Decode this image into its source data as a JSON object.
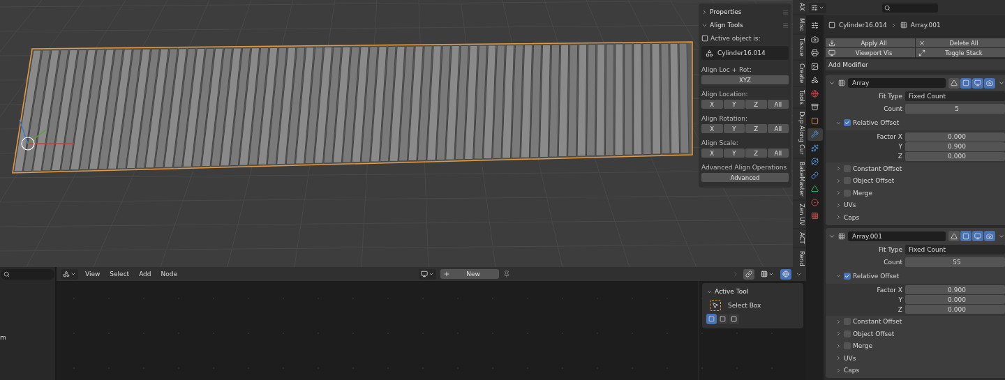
{
  "viewport": {
    "sidebar_panels": [
      {
        "title": "Properties",
        "expanded": false
      },
      {
        "title": "Align Tools",
        "expanded": true
      }
    ],
    "active_object_label": "Active object is:",
    "active_object": "Cylinder16.014",
    "align_groups": [
      {
        "label": "Align Loc + Rot:",
        "buttons": [
          "XYZ"
        ]
      },
      {
        "label": "Align Location:",
        "buttons": [
          "X",
          "Y",
          "Z",
          "All"
        ]
      },
      {
        "label": "Align Rotation:",
        "buttons": [
          "X",
          "Y",
          "Z",
          "All"
        ]
      },
      {
        "label": "Align Scale:",
        "buttons": [
          "X",
          "Y",
          "Z",
          "All"
        ]
      },
      {
        "label": "Advanced Align Operations",
        "buttons": [
          "Advanced"
        ]
      }
    ],
    "tabs": [
      "AX",
      "Misc",
      "Tissue",
      "Create",
      "Tools",
      "Dup Along Cur",
      "BakeMaster",
      "Zen UV",
      "ACT",
      "Rend"
    ]
  },
  "outliner": {
    "partial_text": "m"
  },
  "node_editor": {
    "menus": [
      "View",
      "Select",
      "Add",
      "Node"
    ],
    "new_button": "New",
    "active_tool": {
      "title": "Active Tool",
      "tool": "Select Box",
      "modes": [
        {
          "kind": "set",
          "selected": true
        },
        {
          "kind": "extend",
          "selected": false
        },
        {
          "kind": "subtract",
          "selected": false
        }
      ]
    }
  },
  "properties": {
    "tabs": [
      {
        "kind": "tool",
        "selected": false
      },
      {
        "kind": "render",
        "selected": false
      },
      {
        "kind": "output",
        "selected": false
      },
      {
        "kind": "view_layer",
        "selected": false
      },
      {
        "kind": "scene",
        "selected": false
      },
      {
        "kind": "world",
        "selected": false
      },
      {
        "kind": "collection",
        "selected": false
      },
      {
        "kind": "object",
        "selected": false
      },
      {
        "kind": "modifier",
        "selected": true
      },
      {
        "kind": "particles",
        "selected": false
      },
      {
        "kind": "physics",
        "selected": false
      },
      {
        "kind": "constraints",
        "selected": false
      },
      {
        "kind": "data",
        "selected": false
      },
      {
        "kind": "material",
        "selected": false
      },
      {
        "kind": "texture",
        "selected": false
      }
    ],
    "breadcrumb": [
      "Cylinder16.014",
      "Array.001"
    ],
    "actions": [
      {
        "label": "Apply All",
        "kind": "apply"
      },
      {
        "label": "Delete All",
        "kind": "delete"
      },
      {
        "label": "Viewport Vis",
        "kind": "viewport"
      },
      {
        "label": "Toggle Stack",
        "kind": "stack"
      }
    ],
    "add_modifier": "Add Modifier",
    "modifiers": [
      {
        "name": "Array",
        "expanded": true,
        "toggles": [
          {
            "kind": "cage",
            "on": false
          },
          {
            "kind": "editmode",
            "on": true
          },
          {
            "kind": "viewport",
            "on": true
          },
          {
            "kind": "render",
            "on": true
          }
        ],
        "fields": [
          {
            "label": "Fit Type",
            "value": "Fixed Count",
            "kind": "menu"
          },
          {
            "label": "Count",
            "value": "5",
            "kind": "number"
          }
        ],
        "subpanels": [
          {
            "label": "Relative Offset",
            "kind": "toggle",
            "checked": true,
            "expanded": true,
            "fields": [
              {
                "label": "Factor X",
                "value": "0.000"
              },
              {
                "label": "Y",
                "value": "0.900"
              },
              {
                "label": "Z",
                "value": "0.000"
              }
            ]
          },
          {
            "label": "Constant Offset",
            "kind": "toggle",
            "checked": false,
            "expanded": false
          },
          {
            "label": "Object Offset",
            "kind": "toggle",
            "checked": false,
            "expanded": false
          },
          {
            "label": "Merge",
            "kind": "toggle",
            "checked": false,
            "expanded": false
          },
          {
            "label": "UVs",
            "kind": "plain",
            "expanded": false
          },
          {
            "label": "Caps",
            "kind": "plain",
            "expanded": false
          }
        ]
      },
      {
        "name": "Array.001",
        "expanded": true,
        "toggles": [
          {
            "kind": "cage",
            "on": false
          },
          {
            "kind": "editmode",
            "on": true
          },
          {
            "kind": "viewport",
            "on": true
          },
          {
            "kind": "render",
            "on": true
          }
        ],
        "fields": [
          {
            "label": "Fit Type",
            "value": "Fixed Count",
            "kind": "menu"
          },
          {
            "label": "Count",
            "value": "55",
            "kind": "number"
          }
        ],
        "subpanels": [
          {
            "label": "Relative Offset",
            "kind": "toggle",
            "checked": true,
            "expanded": true,
            "fields": [
              {
                "label": "Factor X",
                "value": "0.900"
              },
              {
                "label": "Y",
                "value": "0.000"
              },
              {
                "label": "Z",
                "value": "0.000"
              }
            ]
          },
          {
            "label": "Constant Offset",
            "kind": "toggle",
            "checked": false,
            "expanded": false
          },
          {
            "label": "Object Offset",
            "kind": "toggle",
            "checked": false,
            "expanded": false
          },
          {
            "label": "Merge",
            "kind": "toggle",
            "checked": false,
            "expanded": false
          },
          {
            "label": "UVs",
            "kind": "plain",
            "expanded": false
          },
          {
            "label": "Caps",
            "kind": "plain",
            "expanded": false
          }
        ]
      }
    ]
  }
}
